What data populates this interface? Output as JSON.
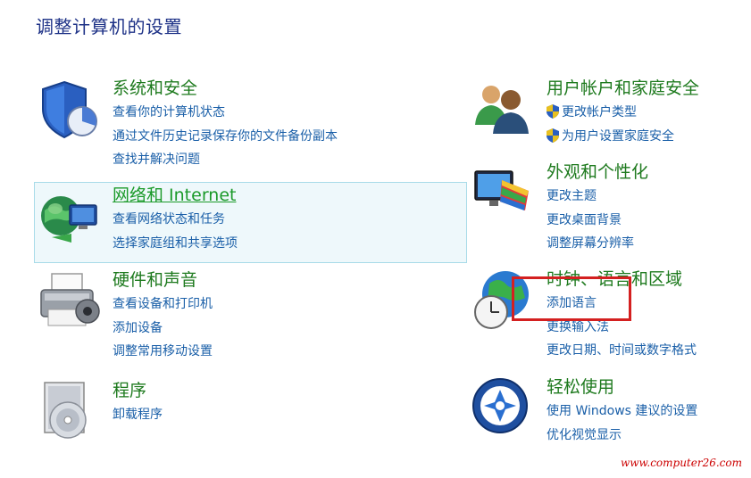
{
  "page": {
    "title": "调整计算机的设置"
  },
  "categories": {
    "system": {
      "title": "系统和安全",
      "links": [
        "查看你的计算机状态",
        "通过文件历史记录保存你的文件备份副本",
        "查找并解决问题"
      ]
    },
    "network": {
      "title": "网络和 Internet",
      "links": [
        "查看网络状态和任务",
        "选择家庭组和共享选项"
      ]
    },
    "hardware": {
      "title": "硬件和声音",
      "links": [
        "查看设备和打印机",
        "添加设备",
        "调整常用移动设置"
      ]
    },
    "programs": {
      "title": "程序",
      "links": [
        "卸载程序"
      ]
    },
    "accounts": {
      "title": "用户帐户和家庭安全",
      "links": [
        "更改帐户类型",
        "为用户设置家庭安全"
      ]
    },
    "appearance": {
      "title": "外观和个性化",
      "links": [
        "更改主题",
        "更改桌面背景",
        "调整屏幕分辨率"
      ]
    },
    "clock": {
      "title": "时钟、语言和区域",
      "links": [
        "添加语言",
        "更换输入法",
        "更改日期、时间或数字格式"
      ]
    },
    "ease": {
      "title": "轻松使用",
      "links": [
        "使用 Windows 建议的设置",
        "优化视觉显示"
      ]
    }
  },
  "watermark": "www.computer26.com",
  "colors": {
    "title": "#1e3287",
    "category_title": "#1e7a1e",
    "link": "#1a5fa8",
    "highlight_bg": "#eef8fb",
    "highlight_border": "#a8dbe8",
    "annotation_box": "#d42020"
  },
  "icons": {
    "system": "shield-chart-icon",
    "network": "globe-network-icon",
    "hardware": "printer-icon",
    "programs": "program-box-icon",
    "accounts": "users-icon",
    "appearance": "monitor-palette-icon",
    "clock": "globe-clock-icon",
    "ease": "ease-of-access-icon",
    "uac": "uac-shield-icon"
  }
}
